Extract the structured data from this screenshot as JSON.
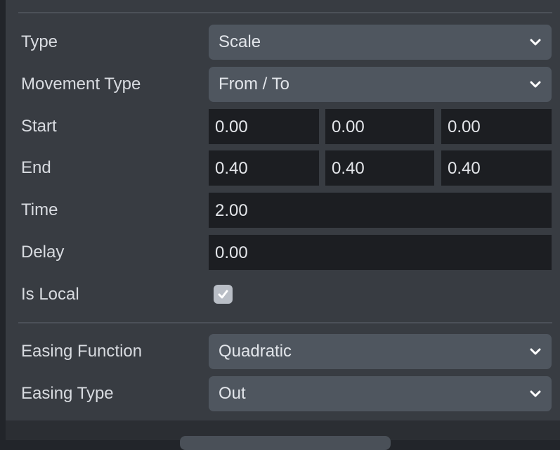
{
  "type": {
    "label": "Type",
    "value": "Scale"
  },
  "movement_type": {
    "label": "Movement Type",
    "value": "From / To"
  },
  "start": {
    "label": "Start",
    "x": "0.00",
    "y": "0.00",
    "z": "0.00"
  },
  "end": {
    "label": "End",
    "x": "0.40",
    "y": "0.40",
    "z": "0.40"
  },
  "time": {
    "label": "Time",
    "value": "2.00"
  },
  "delay": {
    "label": "Delay",
    "value": "0.00"
  },
  "is_local": {
    "label": "Is Local",
    "checked": true
  },
  "easing_function": {
    "label": "Easing Function",
    "value": "Quadratic"
  },
  "easing_type": {
    "label": "Easing Type",
    "value": "Out"
  },
  "icons": {
    "dropdown": "chevron-down-icon",
    "check": "checkmark-icon"
  },
  "colors": {
    "panel": "#383c42",
    "select": "#4f565f",
    "field": "#1c1e22",
    "text": "#d8dbe0",
    "checkbox": "#b9bec6"
  }
}
